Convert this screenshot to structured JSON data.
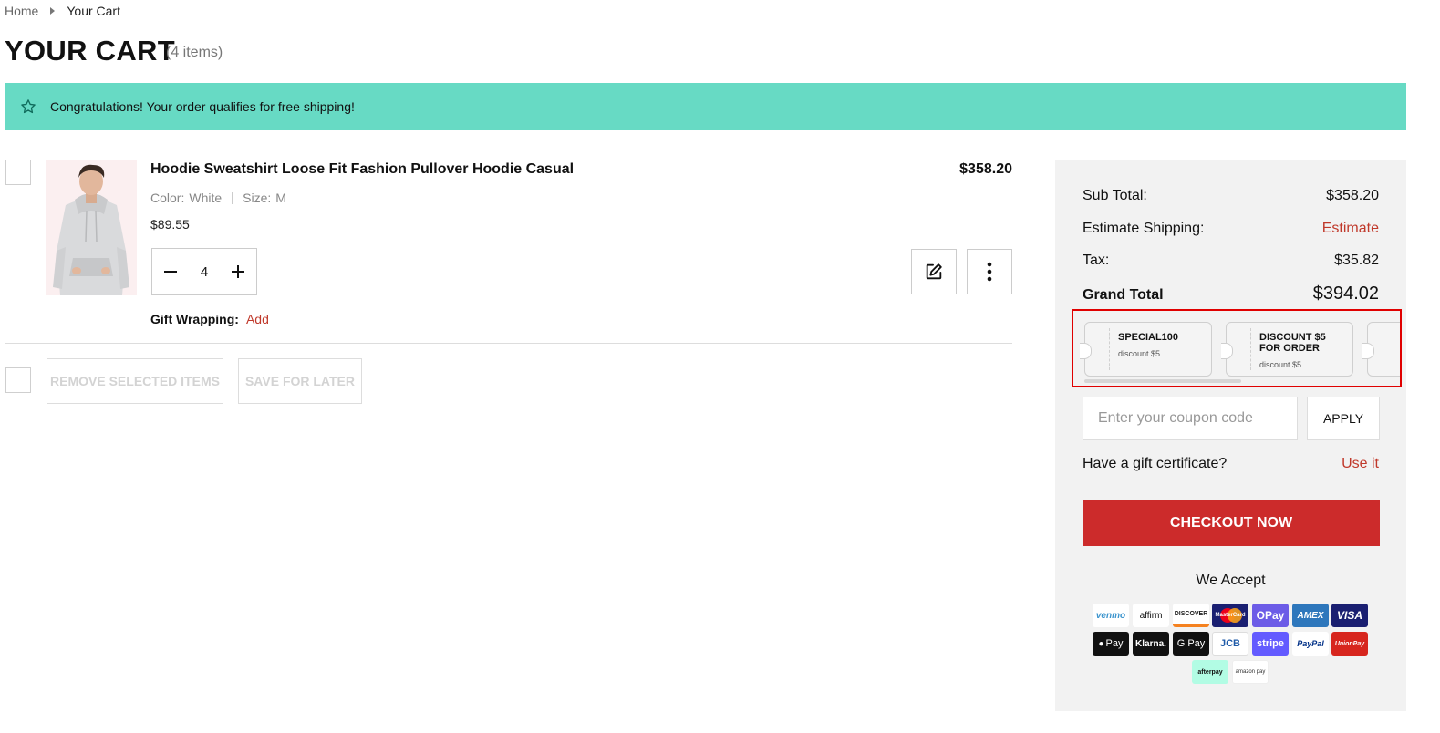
{
  "breadcrumb": {
    "home": "Home",
    "current": "Your Cart"
  },
  "page": {
    "title": "YOUR CART",
    "count": "(4 items)"
  },
  "banner": {
    "text": "Congratulations! Your order qualifies for free shipping!",
    "color": "#67dac4"
  },
  "cart_item": {
    "name": "Hoodie Sweatshirt Loose Fit Fashion Pullover Hoodie Casual",
    "total": "$358.20",
    "color_label": "Color:",
    "color_value": "White",
    "size_label": "Size:",
    "size_value": "M",
    "unit_price": "$89.55",
    "quantity": "4",
    "gift_label": "Gift Wrapping:",
    "gift_action": "Add"
  },
  "actions": {
    "remove": "REMOVE SELECTED ITEMS",
    "save": "SAVE FOR LATER"
  },
  "summary": {
    "subtotal_label": "Sub Total:",
    "subtotal_value": "$358.20",
    "shipping_label": "Estimate Shipping:",
    "shipping_value": "Estimate",
    "tax_label": "Tax:",
    "tax_value": "$35.82",
    "grand_label": "Grand Total",
    "grand_value": "$394.02",
    "coupons": [
      {
        "code": "SPECIAL100",
        "desc": "discount $5"
      },
      {
        "code": "DISCOUNT $5 FOR ORDER",
        "desc": "discount $5"
      }
    ],
    "coupon_placeholder": "Enter your coupon code",
    "apply_label": "APPLY",
    "gift_cert_label": "Have a gift certificate?",
    "gift_cert_action": "Use it",
    "checkout_label": "CHECKOUT NOW",
    "accept_label": "We Accept"
  },
  "payments": {
    "venmo": "venmo",
    "affirm": "affirm",
    "discover": "DISCOVER",
    "mastercard": "MasterCard",
    "opay": "OPay",
    "amex": "AMEX",
    "visa": "VISA",
    "applepay": "Pay",
    "klarna": "Klarna.",
    "gpay": "G Pay",
    "jcb": "JCB",
    "stripe": "stripe",
    "paypal": "PayPal",
    "unionpay": "UnionPay",
    "afterpay": "afterpay",
    "amazonpay": "amazon pay"
  },
  "colors": {
    "accent_red": "#cc2b2b",
    "link_red": "#c0392b",
    "highlight_border": "#e00000"
  }
}
